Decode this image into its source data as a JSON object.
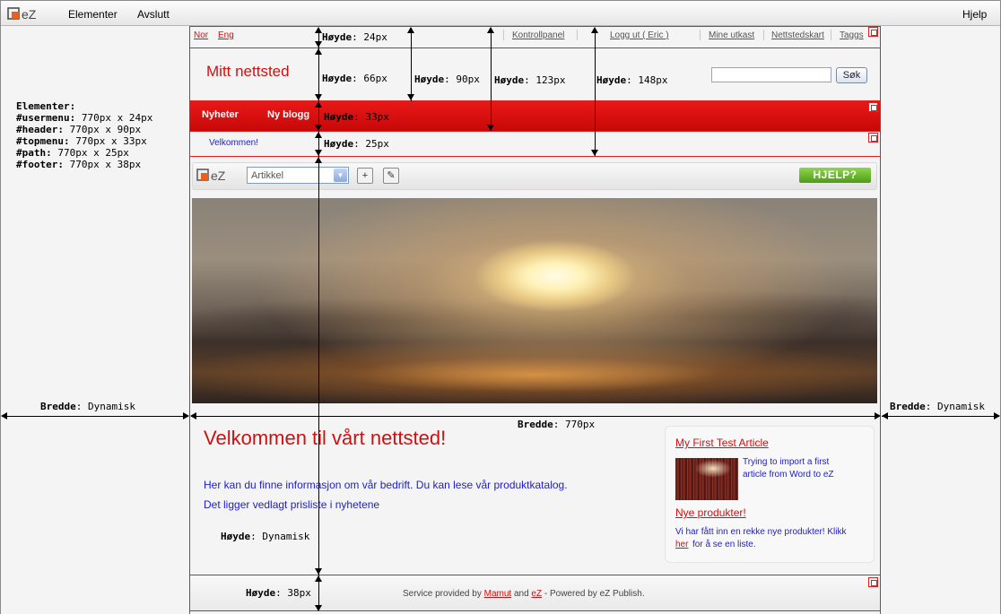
{
  "app_menu": {
    "logo_text": "eZ",
    "items": [
      "Elementer",
      "Avslutt"
    ],
    "help": "Hjelp"
  },
  "usermenu": {
    "languages": [
      "Nor",
      "Eng"
    ],
    "links": [
      "Kontrollpanel",
      "Logg ut ( Eric )",
      "Mine utkast",
      "Nettstedskart",
      "Taggs"
    ]
  },
  "header": {
    "site_name": "Mitt nettsted",
    "search_value": "",
    "search_button": "Søk"
  },
  "topmenu": {
    "items": [
      "Nyheter",
      "Ny blogg"
    ]
  },
  "path": {
    "current": "Velkommen!"
  },
  "toolbar": {
    "logo_text": "eZ",
    "class_select": "Artikkel",
    "help_button": "HJELP?"
  },
  "content": {
    "title": "Velkommen til vårt nettsted!",
    "paragraph_1": "Her kan du finne informasjon om vår bedrift. Du kan lese vår produktkatalog.",
    "paragraph_2": "Det ligger vedlagt prisliste i nyhetene"
  },
  "sidebar": {
    "article_title": "My First Test Article",
    "article_summary_1": "Trying to import a first",
    "article_summary_2": "article from Word to eZ",
    "news_title": "Nye produkter!",
    "news_text_1": "Vi har fått inn en rekke nye produkter! Klikk",
    "news_link": "her",
    "news_text_2": "for å se en liste."
  },
  "footer": {
    "prefix": "Service provided by",
    "link1": "Mamut",
    "middle": "and",
    "link2": "eZ",
    "suffix": "- Powered by eZ Publish."
  },
  "elements_legend": {
    "title": "Elementer:",
    "rows": [
      {
        "name": "#usermenu:",
        "size": "770px x 24px"
      },
      {
        "name": "#header:",
        "size": "770px x 90px"
      },
      {
        "name": "#topmenu:",
        "size": "770px x 33px"
      },
      {
        "name": "#path:",
        "size": "770px x 25px"
      },
      {
        "name": "#footer:",
        "size": "770px x 38px"
      }
    ]
  },
  "measurements": {
    "hoyde_key": "Høyde",
    "bredde_key": "Bredde",
    "h_usermenu": "24px",
    "h_header": "66px",
    "h_90": "90px",
    "h_123": "123px",
    "h_148": "148px",
    "h_topmenu": "33px",
    "h_path": "25px",
    "h_content": "Dynamisk",
    "h_footer": "38px",
    "w_left": "Dynamisk",
    "w_right": "Dynamisk",
    "w_center": "770px"
  }
}
